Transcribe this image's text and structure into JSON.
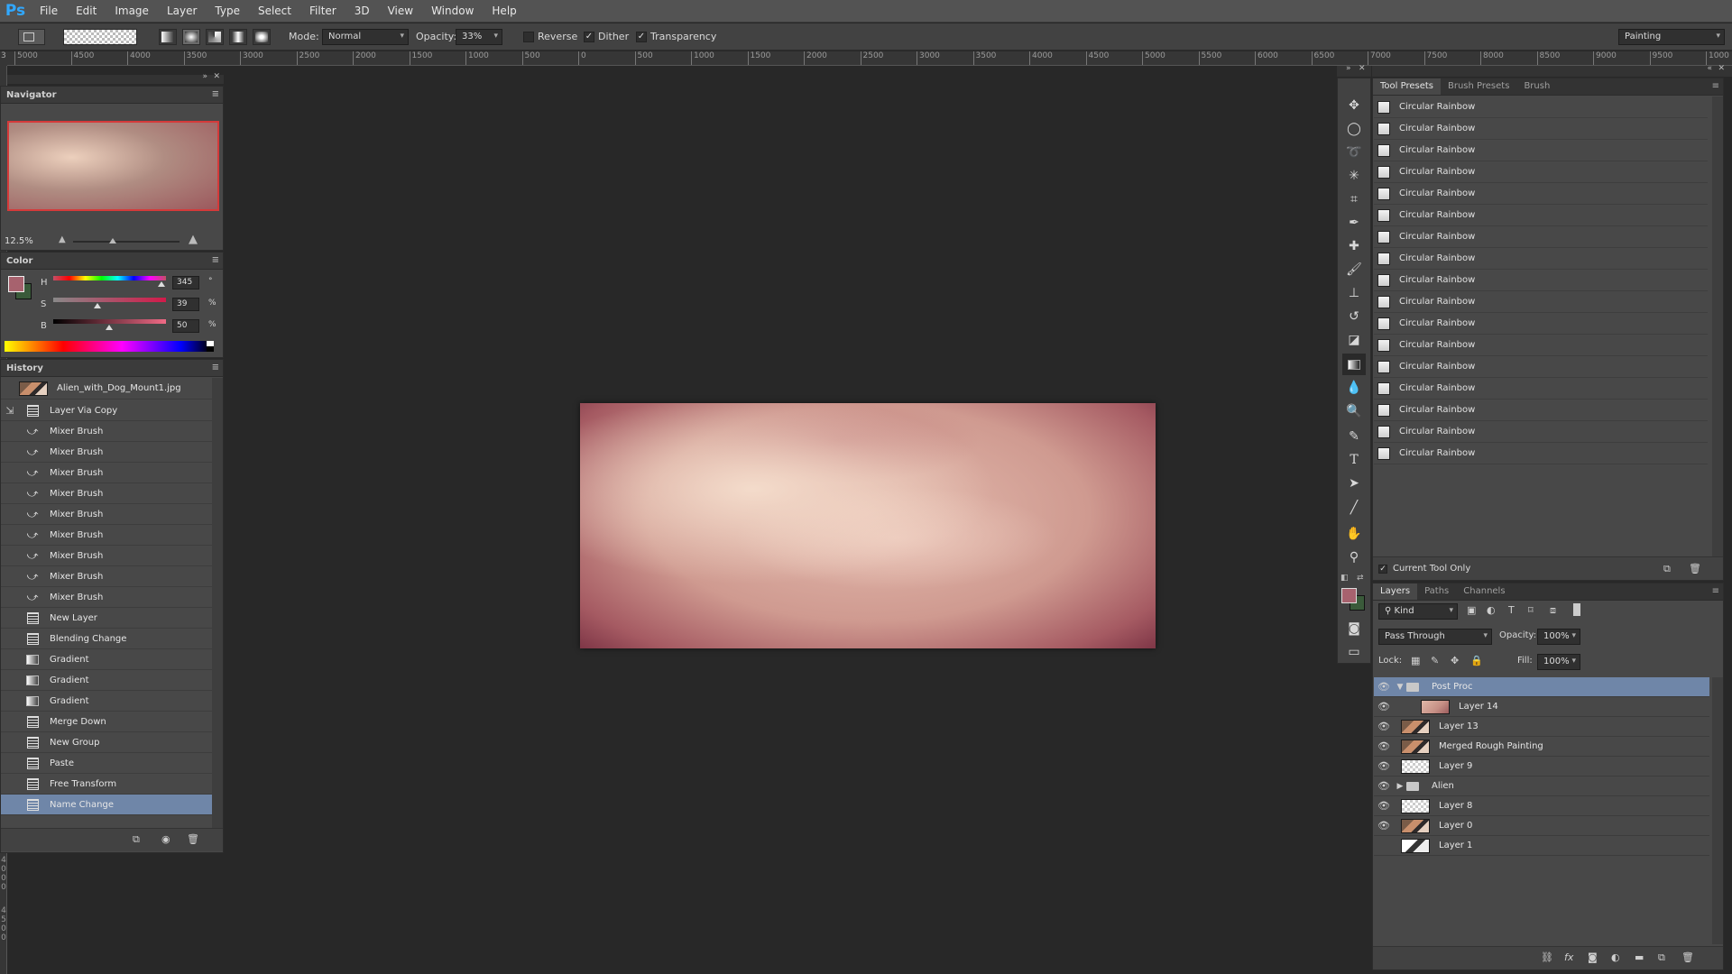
{
  "menubar": {
    "logo": "Ps",
    "items": [
      "File",
      "Edit",
      "Image",
      "Layer",
      "Type",
      "Select",
      "Filter",
      "3D",
      "View",
      "Window",
      "Help"
    ]
  },
  "options": {
    "mode_label": "Mode:",
    "mode_value": "Normal",
    "opacity_label": "Opacity:",
    "opacity_value": "33%",
    "reverse_label": "Reverse",
    "dither_label": "Dither",
    "transparency_label": "Transparency",
    "workspace_value": "Painting"
  },
  "ruler": {
    "ticks": [
      "5000",
      "4500",
      "4000",
      "3500",
      "3000",
      "2500",
      "2000",
      "1500",
      "1000",
      "500",
      "0",
      "500",
      "1000",
      "1500",
      "2000",
      "2500",
      "3000",
      "3500",
      "4000",
      "4500",
      "5000",
      "5500",
      "6000",
      "6500",
      "7000",
      "7500",
      "8000",
      "8500",
      "9000",
      "9500",
      "1000"
    ],
    "corner": "3",
    "vertical": [
      "4",
      "0",
      "0",
      "0",
      "4",
      "5",
      "0",
      "0"
    ]
  },
  "navigator": {
    "title": "Navigator",
    "zoom": "12.5%"
  },
  "color": {
    "title": "Color",
    "fg": "#a7626e",
    "bg": "#3a5a3a",
    "h_label": "H",
    "h_value": "345",
    "h_unit": "°",
    "s_label": "S",
    "s_value": "39",
    "s_unit": "%",
    "b_label": "B",
    "b_value": "50",
    "b_unit": "%"
  },
  "history": {
    "title": "History",
    "snapshot": "Alien_with_Dog_Mount1.jpg",
    "items": [
      {
        "label": "Layer Via Copy",
        "icon": "doc"
      },
      {
        "label": "Mixer Brush",
        "icon": "brush"
      },
      {
        "label": "Mixer Brush",
        "icon": "brush"
      },
      {
        "label": "Mixer Brush",
        "icon": "brush"
      },
      {
        "label": "Mixer Brush",
        "icon": "brush"
      },
      {
        "label": "Mixer Brush",
        "icon": "brush"
      },
      {
        "label": "Mixer Brush",
        "icon": "brush"
      },
      {
        "label": "Mixer Brush",
        "icon": "brush"
      },
      {
        "label": "Mixer Brush",
        "icon": "brush"
      },
      {
        "label": "Mixer Brush",
        "icon": "brush"
      },
      {
        "label": "New Layer",
        "icon": "doc"
      },
      {
        "label": "Blending Change",
        "icon": "doc"
      },
      {
        "label": "Gradient",
        "icon": "gradient"
      },
      {
        "label": "Gradient",
        "icon": "gradient"
      },
      {
        "label": "Gradient",
        "icon": "gradient"
      },
      {
        "label": "Merge Down",
        "icon": "doc"
      },
      {
        "label": "New Group",
        "icon": "doc"
      },
      {
        "label": "Paste",
        "icon": "doc"
      },
      {
        "label": "Free Transform",
        "icon": "doc"
      },
      {
        "label": "Name Change",
        "icon": "doc",
        "selected": true
      }
    ]
  },
  "presets": {
    "tabs": [
      "Tool Presets",
      "Brush Presets",
      "Brush"
    ],
    "items": [
      "Circular Rainbow",
      "Circular Rainbow",
      "Circular Rainbow",
      "Circular Rainbow",
      "Circular Rainbow",
      "Circular Rainbow",
      "Circular Rainbow",
      "Circular Rainbow",
      "Circular Rainbow",
      "Circular Rainbow",
      "Circular Rainbow",
      "Circular Rainbow",
      "Circular Rainbow",
      "Circular Rainbow",
      "Circular Rainbow",
      "Circular Rainbow",
      "Circular Rainbow"
    ],
    "current_tool_only": "Current Tool Only"
  },
  "layers": {
    "tabs": [
      "Layers",
      "Paths",
      "Channels"
    ],
    "kind_label": "Kind",
    "blend_mode": "Pass Through",
    "opacity_label": "Opacity:",
    "opacity_value": "100%",
    "lock_label": "Lock:",
    "fill_label": "Fill:",
    "fill_value": "100%",
    "items": [
      {
        "name": "Post Proc",
        "type": "group-open",
        "visible": true,
        "selected": true
      },
      {
        "name": "Layer 14",
        "type": "child",
        "thumb": "canvas",
        "visible": true
      },
      {
        "name": "Layer 13",
        "type": "layer",
        "thumb": "photo",
        "visible": true
      },
      {
        "name": "Merged Rough Painting",
        "type": "layer",
        "thumb": "photo",
        "visible": true
      },
      {
        "name": "Layer 9",
        "type": "layer",
        "thumb": "checker",
        "visible": true
      },
      {
        "name": "Alien",
        "type": "group-closed",
        "visible": true
      },
      {
        "name": "Layer 8",
        "type": "layer",
        "thumb": "checker",
        "visible": true
      },
      {
        "name": "Layer 0",
        "type": "layer",
        "thumb": "photo",
        "visible": true
      },
      {
        "name": "Layer 1",
        "type": "layer",
        "thumb": "dark",
        "visible": false
      }
    ]
  }
}
